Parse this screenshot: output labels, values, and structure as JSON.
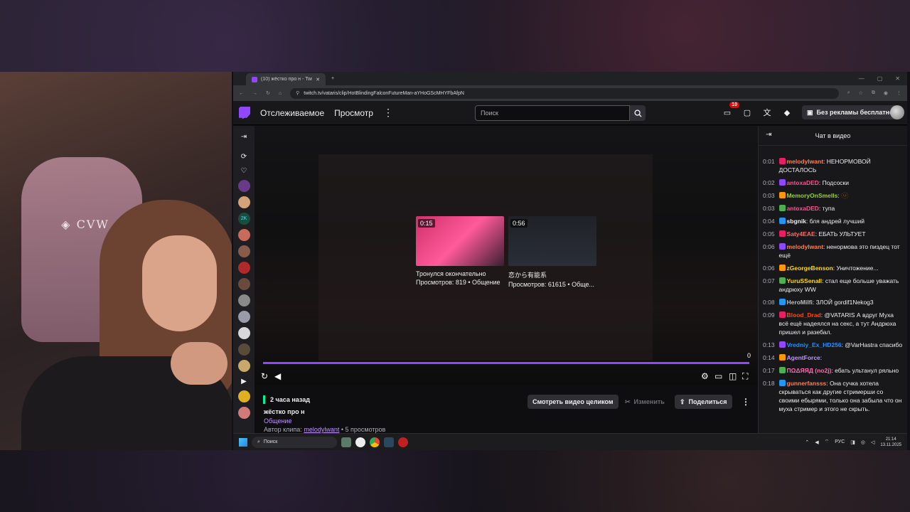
{
  "browser": {
    "tab_title": "(10) жёстко про н - Twitch",
    "url": "twitch.tv/vataris/clip/HotBlindingFalconFutureMan-aYHoGScMHYFbAfpN"
  },
  "topnav": {
    "following": "Отслеживаемое",
    "browse": "Просмотр",
    "search_placeholder": "Поиск",
    "notifications_count": "10",
    "noads_label": "Без рекламы бесплатно"
  },
  "player": {
    "time_right": "0",
    "recommended": [
      {
        "duration": "0:15",
        "title": "Тронулся окончательно",
        "meta": "Просмотров: 819 • Общение"
      },
      {
        "duration": "0:56",
        "title": "恋から有能系",
        "meta": "Просмотров: 61615 • Обще..."
      }
    ]
  },
  "clip_info": {
    "time_ago": "2 часа назад",
    "title": "жёстко про н",
    "category": "Общение",
    "author_prefix": "Автор клипа:",
    "author": "melodylwant",
    "views": "• 5 просмотров",
    "watch_full": "Смотреть видео целиком",
    "edit": "Изменить",
    "share": "Поделиться"
  },
  "chat": {
    "header": "Чат в видео",
    "messages": [
      {
        "ts": "0:01",
        "user": "melodylwant",
        "color": "#ff7f50",
        "text": ": НЕНОРМОВОЙ ДОСТАЛОСЬ"
      },
      {
        "ts": "0:02",
        "user": "antoxaDED",
        "color": "#ff4f8b",
        "text": ": Подсоски"
      },
      {
        "ts": "0:03",
        "user": "MemoryOnSmells",
        "color": "#9acd32",
        "text": ": 🫥"
      },
      {
        "ts": "0:03",
        "user": "antoxaDED",
        "color": "#ff4f8b",
        "text": ": тупа"
      },
      {
        "ts": "0:04",
        "user": "sbgnik",
        "color": "#efeff1",
        "text": ": бля андрей лучший"
      },
      {
        "ts": "0:05",
        "user": "Saty4EAE",
        "color": "#ff6b6b",
        "text": ": ЕБАТЬ УЛЬТУЕТ"
      },
      {
        "ts": "0:06",
        "user": "melodylwant",
        "color": "#ff7f50",
        "text": ": ненормова это пиздец тот ещё"
      },
      {
        "ts": "0:06",
        "user": "zGeorgeBenson",
        "color": "#ffd700",
        "text": ": Уничтожение..."
      },
      {
        "ts": "0:07",
        "user": "YuruSSenall",
        "color": "#ffd700",
        "text": ": стал еще больше уважать андрюху WW"
      },
      {
        "ts": "0:08",
        "user": "HeroMilfi",
        "color": "#bdbdbd",
        "text": ": ЗЛОЙ gordif1Nekog3"
      },
      {
        "ts": "0:09",
        "user": "Blood_Drad",
        "color": "#ff4500",
        "text": ": @VATARIS А вдруг Муха всё ещё надеялся на секс, а тут Андрюха пришел и разебал."
      },
      {
        "ts": "0:13",
        "user": "Vredniy_Ex_HD256",
        "color": "#1e90ff",
        "text": ": @VarHastra спасибо"
      },
      {
        "ts": "0:14",
        "user": "AgentForce",
        "color": "#bf94ff",
        "text": ":"
      },
      {
        "ts": "0:17",
        "user": "ΠΩΔЯЯД (no2j)",
        "color": "#ff69b4",
        "text": ": ебать ультанул ряльно"
      },
      {
        "ts": "0:18",
        "user": "gunnerfansss",
        "color": "#ff7f50",
        "text": ": Она сучка хотела скрываться как другие стримерши со своими ебырями, только она забыла что он муха стример и этого не скрыть."
      }
    ]
  },
  "taskbar": {
    "search": "Поиск",
    "lang": "РУС",
    "time": "21:14",
    "date": "13.11.2025"
  },
  "colors": {
    "accent": "#9146ff",
    "live": "#00f593"
  }
}
